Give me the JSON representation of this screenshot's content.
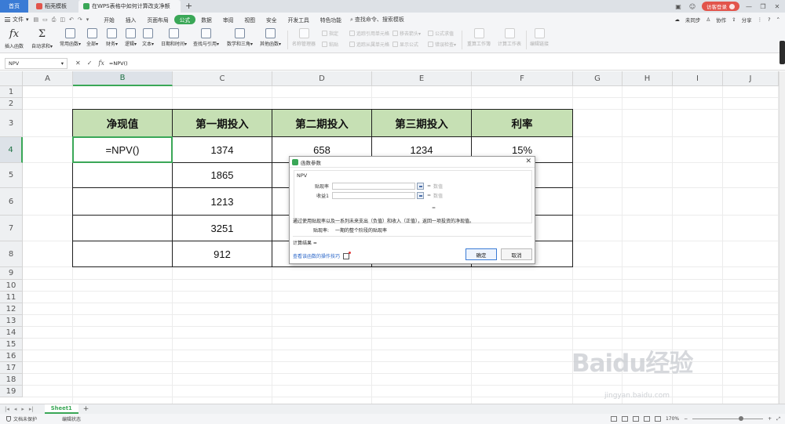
{
  "titlebar": {
    "tabs": [
      {
        "label": "首页"
      },
      {
        "label": "稻壳模板"
      },
      {
        "label": "在WPS表格中如何计算改支净额"
      }
    ],
    "login": "访客登录"
  },
  "menubar": {
    "file": "文件",
    "items": [
      "开始",
      "插入",
      "页面布局",
      "公式",
      "数据",
      "审阅",
      "视图",
      "安全",
      "开发工具",
      "特色功能"
    ],
    "active": "公式",
    "search": "查找命令、搜索模板",
    "right": {
      "sync": "未同步",
      "collab": "协作",
      "share": "分享"
    }
  },
  "ribbon": {
    "buttons": [
      {
        "label": "插入函数"
      },
      {
        "label": "自动求和▾"
      },
      {
        "label": "常用函数▾"
      },
      {
        "label": "全部▾"
      },
      {
        "label": "财务▾"
      },
      {
        "label": "逻辑▾"
      },
      {
        "label": "文本▾"
      },
      {
        "label": "日期和时间▾"
      },
      {
        "label": "查找与引用▾"
      },
      {
        "label": "数学和三角▾"
      },
      {
        "label": "其他函数▾"
      },
      {
        "label": "名称管理器"
      },
      {
        "label": "粘贴"
      },
      {
        "label": "重算工作簿"
      },
      {
        "label": "计算工作表"
      },
      {
        "label": "编辑链接"
      }
    ],
    "small": [
      {
        "label": "指定"
      },
      {
        "label": "追踪引用单元格"
      },
      {
        "label": "移去箭头▾"
      },
      {
        "label": "公式求值"
      },
      {
        "label": "追踪从属单元格"
      },
      {
        "label": "显示公式"
      },
      {
        "label": "错误检查▾"
      }
    ]
  },
  "formula_bar": {
    "name_box": "NPV",
    "input": "=NPV()"
  },
  "columns": [
    "A",
    "B",
    "C",
    "D",
    "E",
    "F",
    "G",
    "H",
    "I",
    "J"
  ],
  "rows": [
    "1",
    "2",
    "3",
    "4",
    "5",
    "6",
    "7",
    "8",
    "9",
    "10",
    "11",
    "12",
    "13",
    "14",
    "15",
    "16",
    "17",
    "18",
    "19"
  ],
  "table": {
    "headers": [
      "净现值",
      "第一期投入",
      "第二期投入",
      "第三期投入",
      "利率"
    ],
    "rows": [
      [
        "=NPV()",
        "1374",
        "658",
        "1234",
        "15%"
      ],
      [
        "",
        "1865",
        "",
        "",
        ""
      ],
      [
        "",
        "1213",
        "",
        "",
        ""
      ],
      [
        "",
        "3251",
        "",
        "",
        ""
      ],
      [
        "",
        "912",
        "",
        "",
        ""
      ]
    ]
  },
  "dialog": {
    "title": "函数参数",
    "function": "NPV",
    "args": [
      {
        "label": "贴现率",
        "eq": "=",
        "value": "数值"
      },
      {
        "label": "收益1",
        "eq": "=",
        "value": "数值"
      }
    ],
    "result_eq": "=",
    "description": "通过使用贴现率以及一系列未来支出（负值）和收入（正值），返回一项投资的净现值。",
    "param_name": "贴现率:",
    "param_desc": "一期的整个阶段的贴现率",
    "result_label": "计算结果 =",
    "help_link": "查看该函数的操作技巧",
    "ok": "确定",
    "cancel": "取消"
  },
  "sheet_tabs": {
    "active": "Sheet1"
  },
  "status": {
    "protect": "文档未保护",
    "edit": "编辑状态",
    "zoom": "170%",
    "zoom_level": 0.7
  },
  "watermark": {
    "text": "Baidu经验",
    "url": "jingyan.baidu.com"
  },
  "colors": {
    "accent_green": "#3aa757",
    "header_fill": "#c6e0b4",
    "home_tab": "#3a7bd5",
    "login": "#e2544b"
  },
  "icons": [
    "fx-icon",
    "sum-icon",
    "close-icon",
    "check-icon",
    "minimize-icon",
    "maximize-icon",
    "search-icon",
    "plus-icon",
    "help-icon"
  ]
}
